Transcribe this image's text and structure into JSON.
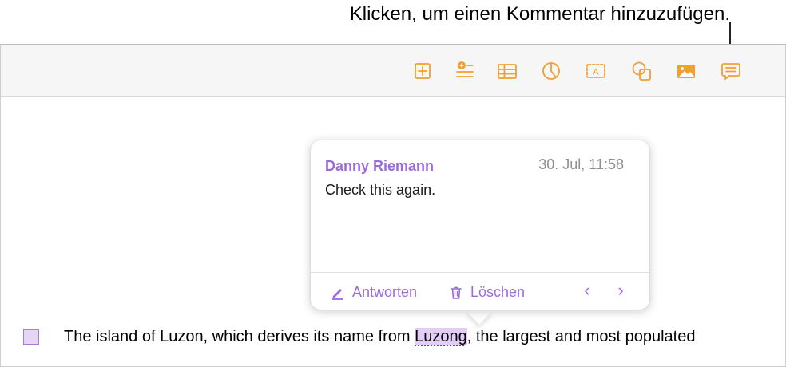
{
  "callout": {
    "text": "Klicken, um einen Kommentar hinzuzufügen."
  },
  "toolbar": {
    "buttons": [
      {
        "icon": "add-page-icon"
      },
      {
        "icon": "insert-list-icon"
      },
      {
        "icon": "table-icon"
      },
      {
        "icon": "chart-icon"
      },
      {
        "icon": "text-box-icon",
        "glyph": "A"
      },
      {
        "icon": "shape-icon"
      },
      {
        "icon": "media-icon"
      },
      {
        "icon": "comment-icon"
      }
    ],
    "accent_color": "#f0a030"
  },
  "comment": {
    "author": "Danny Riemann",
    "date": "30. Jul, 11:58",
    "text": "Check this again.",
    "reply_label": "Antworten",
    "delete_label": "Löschen",
    "prev_glyph": "‹",
    "next_glyph": "›",
    "accent_color": "#9b6bd9"
  },
  "document": {
    "text_before": "The island of Luzon, which derives its name from ",
    "highlighted": "Luzong",
    "text_after": ", the largest and most populated"
  }
}
